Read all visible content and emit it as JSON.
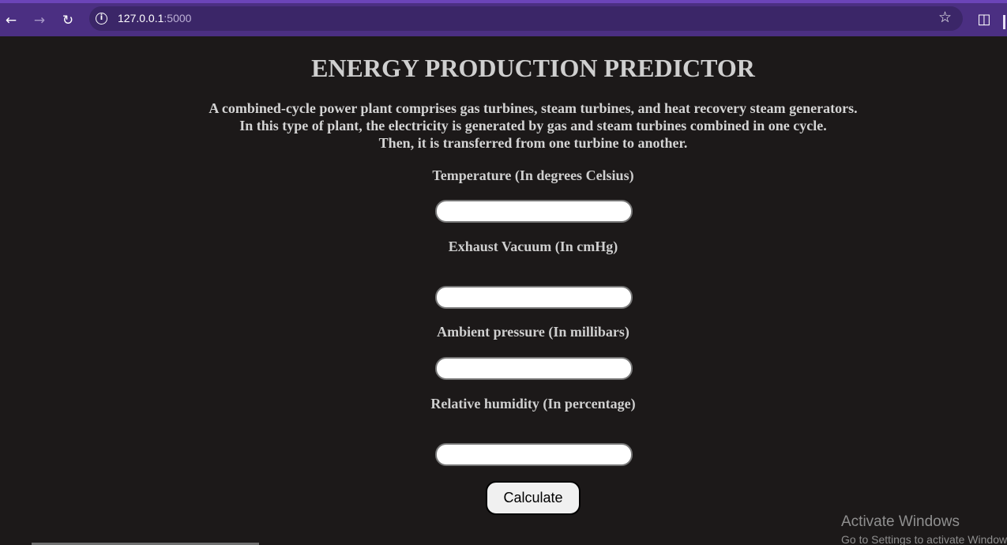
{
  "browser": {
    "url_host": "127.0.0.1",
    "url_port": ":5000",
    "icons": {
      "back": "back-arrow-icon",
      "forward": "forward-arrow-icon",
      "reload": "reload-icon",
      "site_info": "info-icon",
      "bookmark": "star-icon",
      "extensions": "puzzle-icon"
    }
  },
  "page": {
    "title": "ENERGY PRODUCTION PREDICTOR",
    "description": [
      "A combined-cycle power plant comprises gas turbines, steam turbines, and heat recovery steam generators.",
      "In this type of plant, the electricity is generated by gas and steam turbines combined in one cycle.",
      "Then, it is transferred from one turbine to another."
    ],
    "fields": [
      {
        "label": "Temperature (In degrees Celsius)",
        "value": ""
      },
      {
        "label": "Exhaust Vacuum (In cmHg)",
        "value": ""
      },
      {
        "label": "Ambient pressure (In millibars)",
        "value": ""
      },
      {
        "label": "Relative humidity (In percentage)",
        "value": ""
      }
    ],
    "submit_label": "Calculate"
  },
  "watermark": {
    "line1": "Activate Windows",
    "line2": "Go to Settings to activate Windows."
  },
  "colors": {
    "page_background": "#1c1919",
    "browser_frame": "#4b2f82",
    "text": "#cfcfcf"
  }
}
